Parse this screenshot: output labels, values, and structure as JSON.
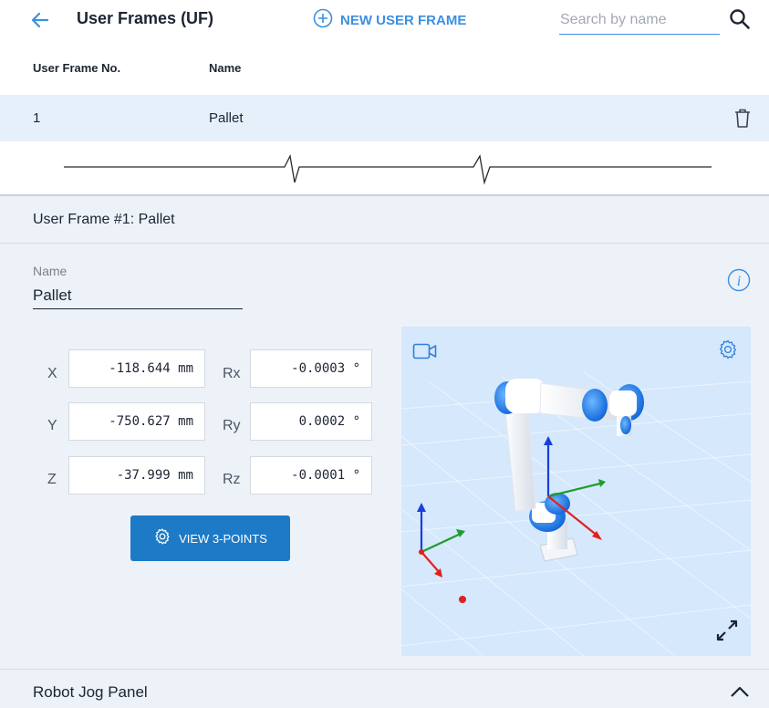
{
  "header": {
    "title": "User Frames (UF)",
    "new_frame_label": "NEW USER FRAME",
    "search_placeholder": "Search by name"
  },
  "table": {
    "columns": [
      "User Frame No.",
      "Name"
    ],
    "rows": [
      {
        "no": "1",
        "name": "Pallet"
      }
    ]
  },
  "detail": {
    "title": "User Frame #1: Pallet",
    "name_label": "Name",
    "name_value": "Pallet",
    "coords": {
      "x_label": "X",
      "x_value": "-118.644 mm",
      "y_label": "Y",
      "y_value": "-750.627 mm",
      "z_label": "Z",
      "z_value": "-37.999 mm",
      "rx_label": "Rx",
      "rx_value": "-0.0003 °",
      "ry_label": "Ry",
      "ry_value": "0.0002 °",
      "rz_label": "Rz",
      "rz_value": "-0.0001 °"
    },
    "view_points_label": "VIEW 3-POINTS"
  },
  "jog_panel": {
    "title": "Robot Jog Panel"
  },
  "colors": {
    "accent": "#3d8fe0",
    "primary_button": "#1d7ac7",
    "selected_row": "#e6f0fb",
    "panel_bg": "#edf2f8",
    "viewer_bg": "#d5e8fc"
  },
  "icons": [
    "arrow-left-icon",
    "plus-circle-icon",
    "search-icon",
    "trash-icon",
    "info-icon",
    "gear-icon",
    "video-camera-icon",
    "expand-icon",
    "chevron-up-icon"
  ]
}
